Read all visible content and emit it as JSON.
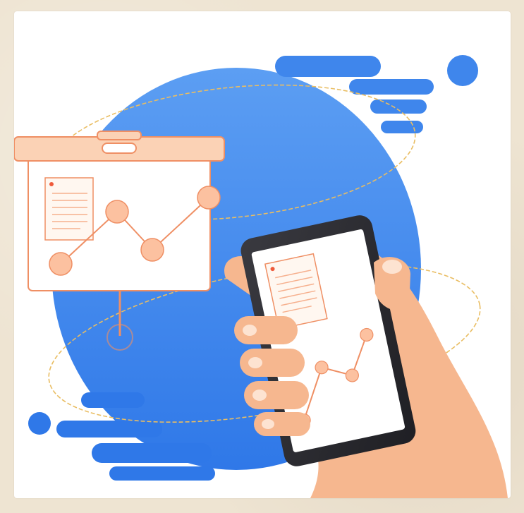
{
  "illustration": {
    "subject": "hand-holding-phone-with-chart",
    "colors": {
      "blob": "#3f86ec",
      "blob_light": "#6aa6f5",
      "board_fill": "#fbd2b5",
      "board_stroke": "#ef8f64",
      "chart_point": "#fcc1a0",
      "skin": "#f6b78f",
      "skin_shadow": "#e99a6f",
      "phone_body": "#2e2e33",
      "orbit": "#e9bd62"
    },
    "icons": [
      "presentation-board-icon",
      "document-icon",
      "smartphone-icon",
      "hand-icon",
      "line-chart-icon"
    ]
  }
}
